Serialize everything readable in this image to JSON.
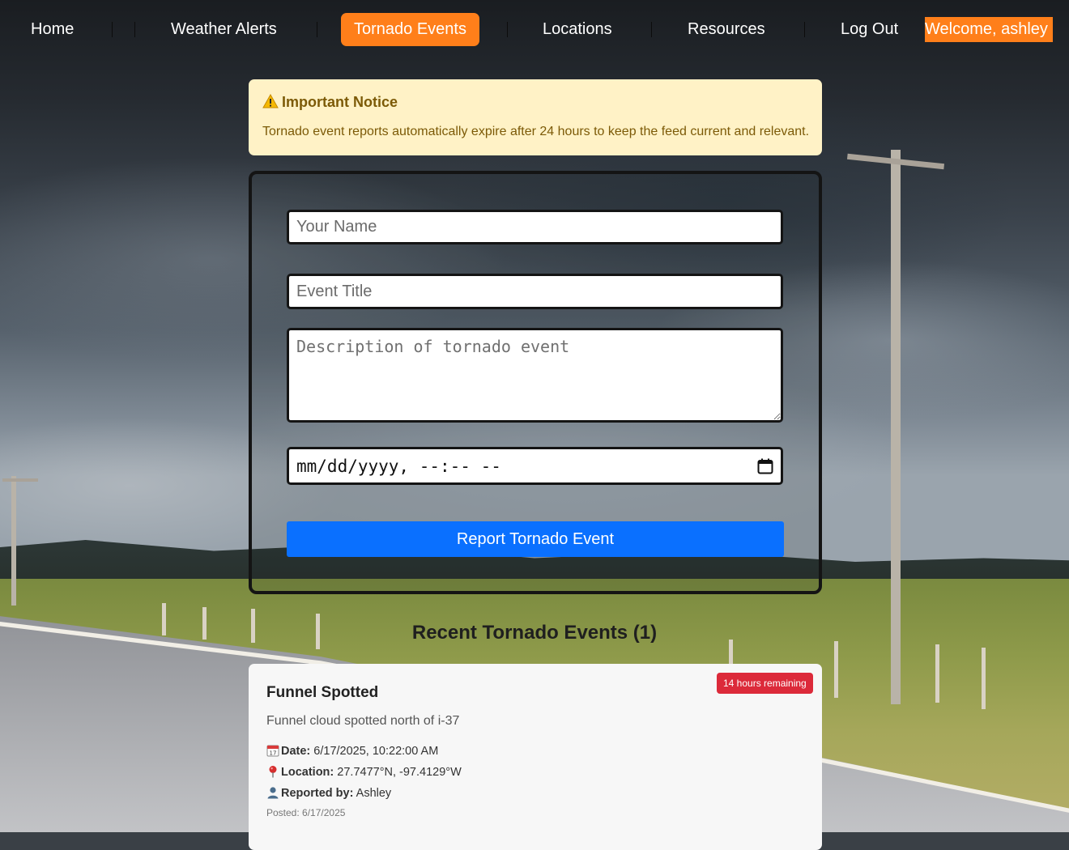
{
  "nav": {
    "items": [
      {
        "label": "Home"
      },
      {
        "label": "Weather Alerts"
      },
      {
        "label": "Tornado Events",
        "active": true
      },
      {
        "label": "Locations"
      },
      {
        "label": "Resources"
      },
      {
        "label": "Log Out"
      }
    ],
    "welcome": "Welcome, ashley",
    "accent_color": "#ff7f1a"
  },
  "notice": {
    "icon": "warning-icon",
    "title": "Important Notice",
    "text": "Tornado event reports automatically expire after 24 hours to keep the feed current and relevant."
  },
  "form": {
    "name_placeholder": "Your Name",
    "title_placeholder": "Event Title",
    "description_placeholder": "Description of tornado event",
    "datetime_placeholder": "mm/dd/yyyy, --:-- --",
    "submit_label": "Report Tornado Event",
    "submit_color": "#0a70ff"
  },
  "recent": {
    "heading": "Recent Tornado Events (1)",
    "events": [
      {
        "badge": "14 hours remaining",
        "badge_color": "#dc2a3a",
        "title": "Funnel Spotted",
        "description": "Funnel cloud spotted north of i-37",
        "date_label": "Date:",
        "date_value": "6/17/2025, 10:22:00 AM",
        "location_label": "Location:",
        "location_value": "27.7477°N, -97.4129°W",
        "reporter_label": "Reported by:",
        "reporter_value": "Ashley",
        "posted": "Posted: 6/17/2025"
      }
    ]
  }
}
